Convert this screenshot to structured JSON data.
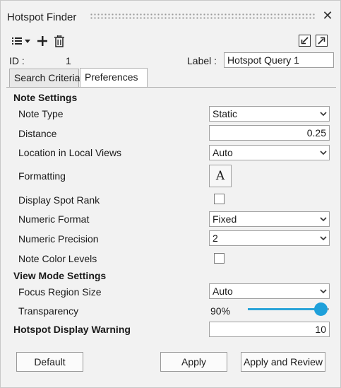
{
  "window": {
    "title": "Hotspot Finder",
    "close_glyph": "✕"
  },
  "toolbar": {
    "list_icon": "list-icon",
    "add_icon": "plus-icon",
    "delete_icon": "trash-icon",
    "collapse_icon": "collapse-icon",
    "expand_icon": "expand-icon"
  },
  "header": {
    "id_label": "ID :",
    "id_value": "1",
    "label_label": "Label :",
    "label_value": "Hotspot Query 1"
  },
  "tabs": [
    {
      "label": "Search Criteria",
      "active": false
    },
    {
      "label": "Preferences",
      "active": true
    }
  ],
  "note_settings": {
    "heading": "Note Settings",
    "note_type": {
      "label": "Note Type",
      "value": "Static"
    },
    "distance": {
      "label": "Distance",
      "value": "0.25"
    },
    "location": {
      "label": "Location in Local Views",
      "value": "Auto"
    },
    "formatting": {
      "label": "Formatting",
      "button": "A"
    },
    "spot_rank": {
      "label": "Display Spot Rank",
      "checked": false
    },
    "numeric_format": {
      "label": "Numeric Format",
      "value": "Fixed"
    },
    "numeric_precision": {
      "label": "Numeric Precision",
      "value": "2"
    },
    "color_levels": {
      "label": "Note Color Levels",
      "checked": false
    }
  },
  "view_mode": {
    "heading": "View Mode Settings",
    "focus_region": {
      "label": "Focus Region Size",
      "value": "Auto"
    },
    "transparency": {
      "label": "Transparency",
      "value_text": "90%",
      "fraction": 0.9
    }
  },
  "warning": {
    "label": "Hotspot Display Warning",
    "value": "10"
  },
  "buttons": {
    "default": "Default",
    "apply": "Apply",
    "apply_review": "Apply and Review"
  },
  "colors": {
    "accent": "#1ea0da",
    "panel_bg": "#f2f2f2"
  }
}
